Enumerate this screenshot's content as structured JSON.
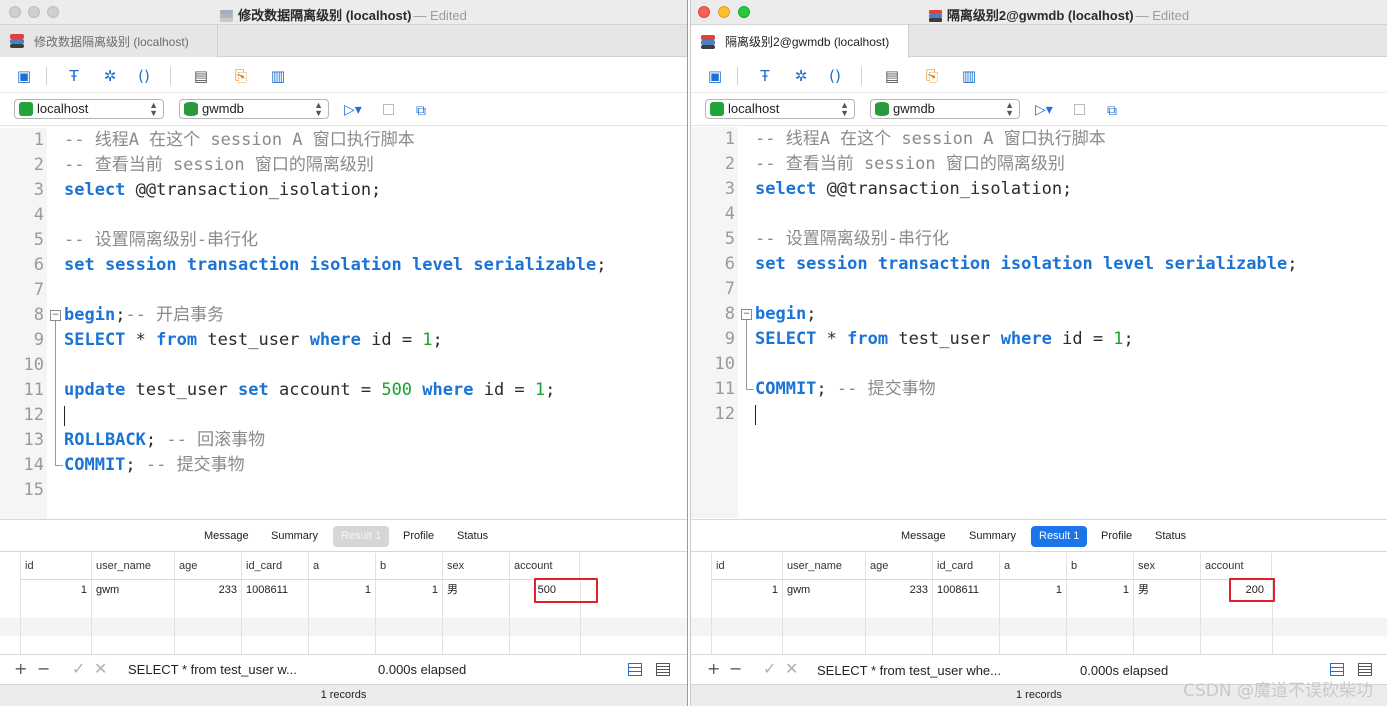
{
  "left": {
    "window_title": "修改数据隔离级别 (localhost)",
    "edited": "— Edited",
    "tab_label": "修改数据隔离级别 (localhost)",
    "connection": "localhost",
    "database": "gwmdb",
    "lines": [
      {
        "n": "1"
      },
      {
        "n": "2"
      },
      {
        "n": "3"
      },
      {
        "n": "4"
      },
      {
        "n": "5"
      },
      {
        "n": "6"
      },
      {
        "n": "7"
      },
      {
        "n": "8"
      },
      {
        "n": "9"
      },
      {
        "n": "10"
      },
      {
        "n": "11"
      },
      {
        "n": "12"
      },
      {
        "n": "13"
      },
      {
        "n": "14"
      },
      {
        "n": "15"
      }
    ],
    "code": {
      "l1": "-- 线程A 在这个 session A 窗口执行脚本",
      "l2": "-- 查看当前 session 窗口的隔离级别",
      "l3_kw": "select",
      "l3_rest": " @@transaction_isolation;",
      "l5": "-- 设置隔离级别-串行化",
      "l6_kw": "set session transaction isolation level serializable",
      "l6_rest": ";",
      "l8_kw": "begin",
      "l8_rest": ";",
      "l8_cm": "-- 开启事务",
      "l9_kw1": "SELECT",
      "l9_mid": " * ",
      "l9_kw2": "from",
      "l9_tbl": " test_user ",
      "l9_kw3": "where",
      "l9_cond": " id = ",
      "l9_num": "1",
      "l9_end": ";",
      "l11_kw1": "update",
      "l11_tbl": " test_user ",
      "l11_kw2": "set",
      "l11_col": " account = ",
      "l11_num1": "500",
      "l11_sp": " ",
      "l11_kw3": "where",
      "l11_cond": " id = ",
      "l11_num2": "1",
      "l11_end": ";",
      "l13_kw": "ROLLBACK",
      "l13_rest": "; ",
      "l13_cm": "-- 回滚事物",
      "l14_kw": "COMMIT",
      "l14_rest": "; ",
      "l14_cm": "-- 提交事物"
    },
    "result_tabs": [
      "Message",
      "Summary",
      "Result 1",
      "Profile",
      "Status"
    ],
    "columns": [
      "id",
      "user_name",
      "age",
      "id_card",
      "a",
      "b",
      "sex",
      "account"
    ],
    "row": [
      "1",
      "gwm",
      "233",
      "1008611",
      "1",
      "1",
      "男",
      "500"
    ],
    "status_sql": "SELECT * from test_user w...",
    "elapsed": "0.000s elapsed",
    "records": "1 records"
  },
  "right": {
    "window_title": "隔离级别2@gwmdb (localhost)",
    "edited": "— Edited",
    "tab_label": "隔离级别2@gwmdb (localhost)",
    "connection": "localhost",
    "database": "gwmdb",
    "code": {
      "l1": "-- 线程A 在这个 session A 窗口执行脚本",
      "l2": "-- 查看当前 session 窗口的隔离级别",
      "l3_kw": "select",
      "l3_rest": " @@transaction_isolation;",
      "l5": "-- 设置隔离级别-串行化",
      "l6_kw": "set session transaction isolation level serializable",
      "l6_rest": ";",
      "l8_kw": "begin",
      "l8_rest": ";",
      "l9_kw1": "SELECT",
      "l9_mid": " * ",
      "l9_kw2": "from",
      "l9_tbl": " test_user ",
      "l9_kw3": "where",
      "l9_cond": " id = ",
      "l9_num": "1",
      "l9_end": ";",
      "l11_kw": "COMMIT",
      "l11_rest": "; ",
      "l11_cm": "-- 提交事物"
    },
    "result_tabs": [
      "Message",
      "Summary",
      "Result 1",
      "Profile",
      "Status"
    ],
    "columns": [
      "id",
      "user_name",
      "age",
      "id_card",
      "a",
      "b",
      "sex",
      "account"
    ],
    "row": [
      "1",
      "gwm",
      "233",
      "1008611",
      "1",
      "1",
      "男",
      "200"
    ],
    "status_sql": "SELECT * from test_user whe...",
    "elapsed": "0.000s elapsed",
    "records": "1 records"
  },
  "toolbar_icons": [
    "save-icon",
    "format-icon",
    "beautify-icon",
    "brackets-icon",
    "snippet-icon",
    "export-icon",
    "chart-icon"
  ],
  "status_icons": {
    "add": "+",
    "remove": "−",
    "apply": "✓",
    "discard": "✕"
  },
  "watermark": "CSDN @魔道不误砍柴功",
  "colors": {
    "keyword": "#1a73d6",
    "comment": "#8a8a8a",
    "number": "#19a32e",
    "accent": "#1c75e8",
    "highlight": "#e0202a"
  }
}
